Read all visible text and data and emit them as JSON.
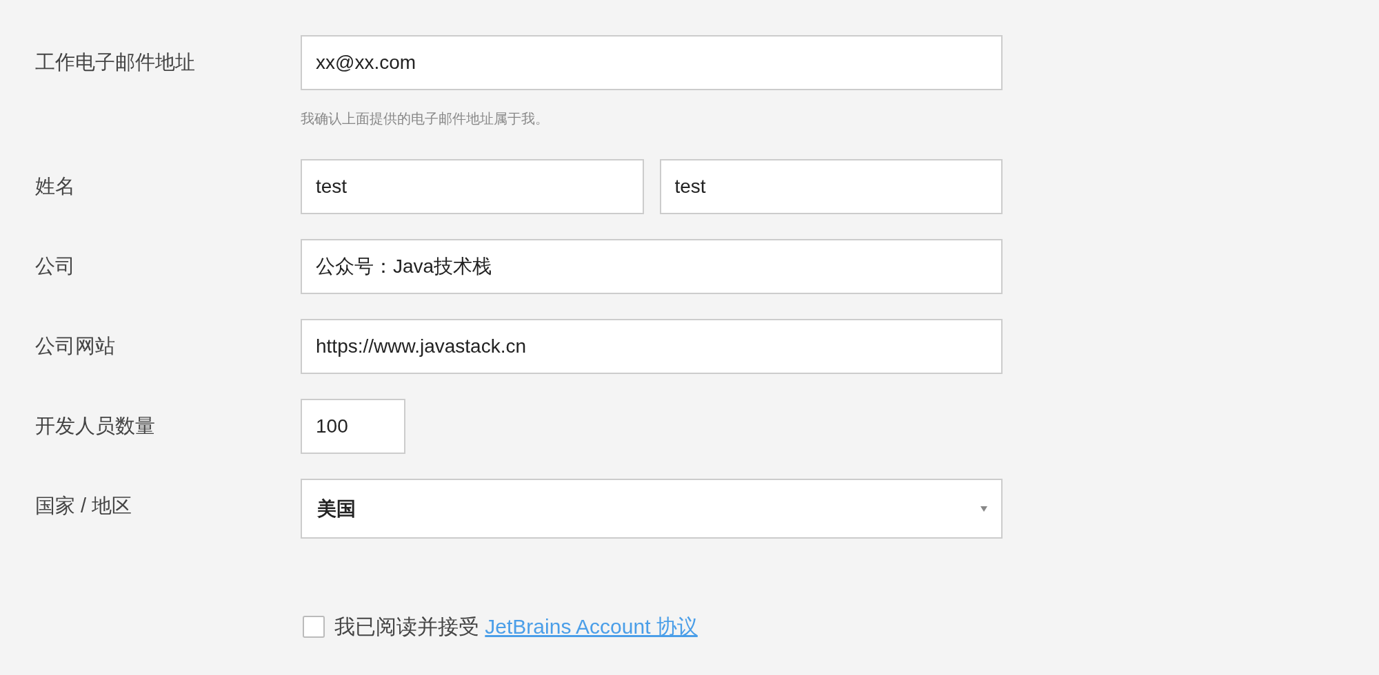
{
  "fields": [
    {
      "kind": "text",
      "label": "工作电子邮件地址",
      "values": [
        "xx@xx.com"
      ],
      "hint": "我确认上面提供的电子邮件地址属于我。"
    },
    {
      "kind": "split",
      "label": "姓名",
      "values": [
        "test",
        "test"
      ]
    },
    {
      "kind": "text",
      "label": "公司",
      "values": [
        "公众号：Java技术栈"
      ]
    },
    {
      "kind": "text",
      "label": "公司网站",
      "values": [
        "https://www.javastack.cn"
      ]
    },
    {
      "kind": "short",
      "label": "开发人员数量",
      "values": [
        "100"
      ]
    },
    {
      "kind": "select",
      "label": "国家 / 地区",
      "values": [
        "美国"
      ]
    }
  ],
  "agreement": {
    "checked": false,
    "text": "我已阅读并接受",
    "link": "JetBrains Account 协议"
  }
}
